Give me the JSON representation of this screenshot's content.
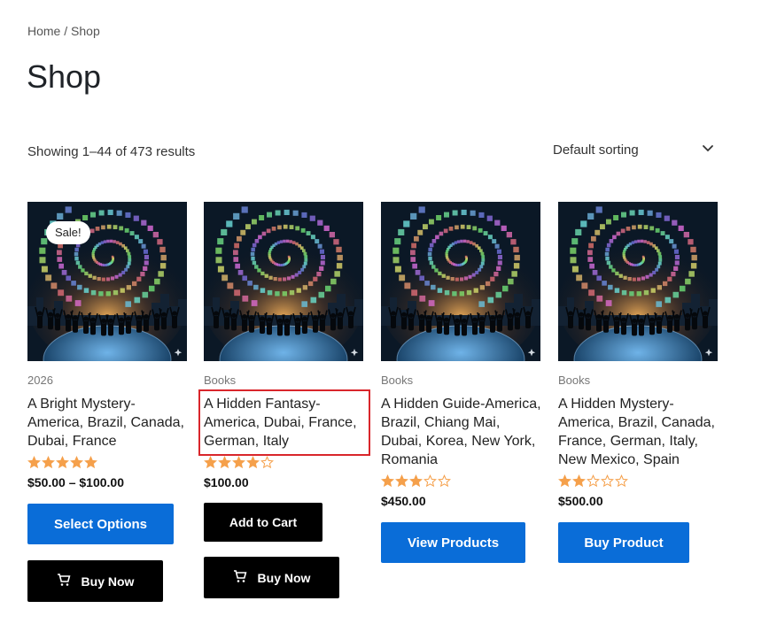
{
  "breadcrumb": {
    "home": "Home",
    "separator": " / ",
    "current": "Shop"
  },
  "page_title": "Shop",
  "result_count": "Showing 1–44 of 473 results",
  "sorting": {
    "selected": "Default sorting"
  },
  "colors": {
    "accent": "#0a6dd8",
    "star": "#f5a04b",
    "highlight": "#d9262b"
  },
  "products": [
    {
      "badge": "Sale!",
      "category": "2026",
      "title": "A Bright Mystery-America, Brazil, Canada, Dubai, France",
      "rating": 5,
      "price": "$50.00 – $100.00",
      "primary_button": "Select Options",
      "secondary_button": "Buy Now"
    },
    {
      "category": "Books",
      "title": "A Hidden Fantasy-America, Dubai, France, German, Italy",
      "rating": 4,
      "price": "$100.00",
      "primary_button": "Add to Cart",
      "secondary_button": "Buy Now"
    },
    {
      "category": "Books",
      "title": "A Hidden Guide-America, Brazil, Chiang Mai, Dubai, Korea, New York, Romania",
      "rating": 3,
      "price": "$450.00",
      "primary_button": "View Products"
    },
    {
      "category": "Books",
      "title": "A Hidden Mystery-America, Brazil, Canada, France, German, Italy, New Mexico, Spain",
      "rating": 2,
      "price": "$500.00",
      "primary_button": "Buy Product"
    }
  ]
}
